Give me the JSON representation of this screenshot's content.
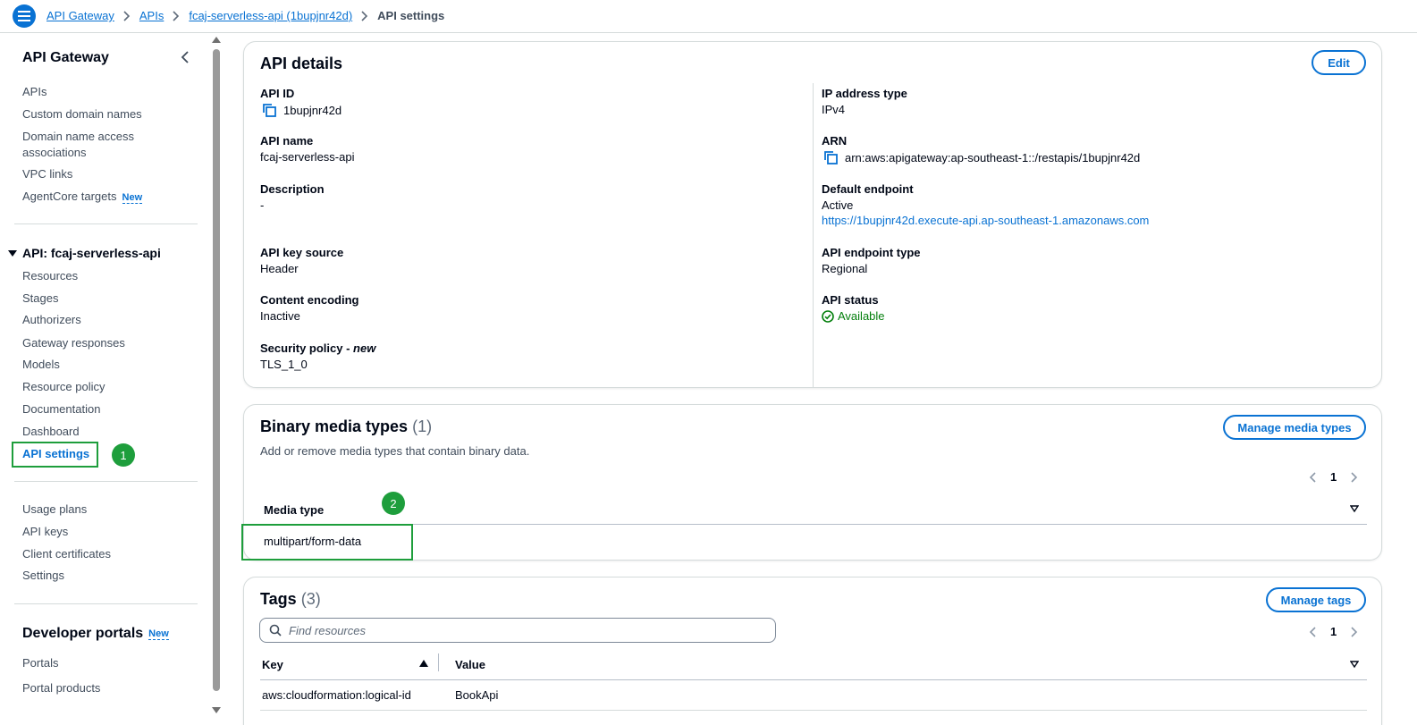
{
  "breadcrumb": {
    "items": [
      "API Gateway",
      "APIs",
      "fcaj-serverless-api (1bupjnr42d)"
    ],
    "current": "API settings"
  },
  "sidebar": {
    "title": "API Gateway",
    "top_items": [
      "APIs",
      "Custom domain names",
      "Domain name access associations",
      "VPC links",
      "AgentCore targets"
    ],
    "new_label": "New",
    "api_section": "API: fcaj-serverless-api",
    "api_items": [
      "Resources",
      "Stages",
      "Authorizers",
      "Gateway responses",
      "Models",
      "Resource policy",
      "Documentation",
      "Dashboard"
    ],
    "active_item": "API settings",
    "bottom_items": [
      "Usage plans",
      "API keys",
      "Client certificates",
      "Settings"
    ],
    "dev_title": "Developer portals",
    "dev_items": [
      "Portals",
      "Portal products"
    ]
  },
  "annotations": [
    "1",
    "2"
  ],
  "api_details": {
    "title": "API details",
    "edit_label": "Edit",
    "api_id_label": "API ID",
    "api_id": "1bupjnr42d",
    "api_name_label": "API name",
    "api_name": "fcaj-serverless-api",
    "description_label": "Description",
    "description": "-",
    "key_source_label": "API key source",
    "key_source": "Header",
    "content_encoding_label": "Content encoding",
    "content_encoding": "Inactive",
    "security_policy_label": "Security policy - ",
    "security_policy_new": "new",
    "security_policy": "TLS_1_0",
    "ip_type_label": "IP address type",
    "ip_type": "IPv4",
    "arn_label": "ARN",
    "arn": "arn:aws:apigateway:ap-southeast-1::/restapis/1bupjnr42d",
    "endpoint_label": "Default endpoint",
    "endpoint_status": "Active",
    "endpoint_url": "https://1bupjnr42d.execute-api.ap-southeast-1.amazonaws.com",
    "endpoint_type_label": "API endpoint type",
    "endpoint_type": "Regional",
    "status_label": "API status",
    "status": "Available"
  },
  "binary_media": {
    "title": "Binary media types",
    "count": "(1)",
    "description": "Add or remove media types that contain binary data.",
    "manage_label": "Manage media types",
    "page": "1",
    "column": "Media type",
    "rows": [
      "multipart/form-data"
    ]
  },
  "tags": {
    "title": "Tags",
    "count": "(3)",
    "manage_label": "Manage tags",
    "search_placeholder": "Find resources",
    "page": "1",
    "col_key": "Key",
    "col_value": "Value",
    "rows": [
      {
        "key": "aws:cloudformation:logical-id",
        "value": "BookApi"
      }
    ]
  },
  "colors": {
    "link": "#0972d3",
    "success": "#037f0c",
    "annotation": "#1e9e3c"
  }
}
